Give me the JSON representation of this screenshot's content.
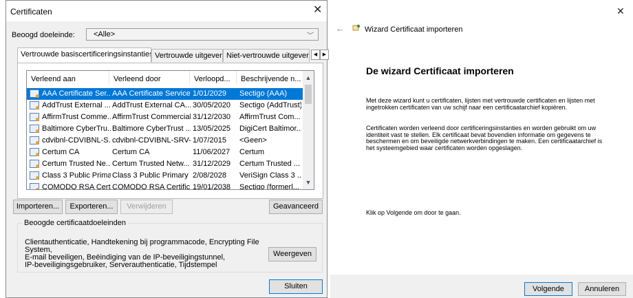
{
  "cert_dialog": {
    "title": "Certificaten",
    "purpose_label": "Beoogd doeleinde:",
    "purpose_value": "<Alle>",
    "tabs": [
      {
        "label": "Vertrouwde basiscertificeringsinstanties",
        "active": true
      },
      {
        "label": "Vertrouwde uitgevers",
        "active": false
      },
      {
        "label": "Niet-vertrouwde uitgever",
        "active": false
      }
    ],
    "columns": [
      "Verleend aan",
      "Verleend door",
      "Verloopd...",
      "Beschrijvende n..."
    ],
    "rows": [
      {
        "issued_to": "AAA Certificate Ser...",
        "issued_by": "AAA Certificate Services",
        "expires": "1/01/2029",
        "friendly": "Sectigo (AAA)",
        "selected": true
      },
      {
        "issued_to": "AddTrust External ...",
        "issued_by": "AddTrust External CA...",
        "expires": "30/05/2020",
        "friendly": "Sectigo (AddTrust)"
      },
      {
        "issued_to": "AffirmTrust Comme...",
        "issued_by": "AffirmTrust Commercial",
        "expires": "31/12/2030",
        "friendly": "AffirmTrust Com..."
      },
      {
        "issued_to": "Baltimore CyberTru...",
        "issued_by": "Baltimore CyberTrust ...",
        "expires": "13/05/2025",
        "friendly": "DigiCert Baltimor..."
      },
      {
        "issued_to": "cdvibnl-CDVIBNL-S...",
        "issued_by": "cdvibnl-CDVIBNL-SRV-...",
        "expires": "1/07/2015",
        "friendly": "<Geen>"
      },
      {
        "issued_to": "Certum CA",
        "issued_by": "Certum CA",
        "expires": "11/06/2027",
        "friendly": "Certum"
      },
      {
        "issued_to": "Certum Trusted Ne...",
        "issued_by": "Certum Trusted Netw...",
        "expires": "31/12/2029",
        "friendly": "Certum Trusted ..."
      },
      {
        "issued_to": "Class 3 Public Prima...",
        "issued_by": "Class 3 Public Primary ...",
        "expires": "2/08/2028",
        "friendly": "VeriSign Class 3 ..."
      },
      {
        "issued_to": "COMODO RSA Cert...",
        "issued_by": "COMODO RSA Certific...",
        "expires": "19/01/2038",
        "friendly": "Sectigo (formerl..."
      }
    ],
    "buttons": {
      "import": "Importeren...",
      "export": "Exporteren...",
      "remove": "Verwijderen",
      "advanced": "Geavanceerd",
      "view": "Weergeven",
      "close": "Sluiten"
    },
    "purposes_group_label": "Beoogde certificaatdoeleinden",
    "purposes_lines": [
      "Clientauthenticatie, Handtekening bij programmacode, Encrypting File System,",
      "E-mail beveiligen, Beëindiging van de IP-beveiligingstunnel,",
      "IP-beveiligingsgebruiker, Serverauthenticatie, Tijdstempel"
    ]
  },
  "wizard": {
    "title": "Wizard Certificaat importeren",
    "heading": "De wizard Certificaat importeren",
    "para1_lines": [
      "Met deze wizard kunt u certificaten, lijsten met vertrouwde certificaten en lijsten met",
      "ingetrokken certificaten van uw schijf naar een certificaatarchief kopiëren."
    ],
    "para2_lines": [
      "Certificaten worden verleend door certificeringsinstanties en worden gebruikt om uw",
      "identiteit vast te stellen. Elk certificaat bevat bovendien informatie om gegevens te",
      "beschermen en om beveiligde netwerkverbindingen te maken. Een certificaatarchief is",
      "het systeemgebied waar certificaten worden opgeslagen."
    ],
    "next_hint": "Klik op Volgende om door te gaan.",
    "buttons": {
      "next": "Volgende",
      "cancel": "Annuleren"
    }
  },
  "icons": {
    "close": "close-icon",
    "back": "back-arrow-icon",
    "wizard": "certificate-wizard-icon",
    "cert": "certificate-icon"
  }
}
